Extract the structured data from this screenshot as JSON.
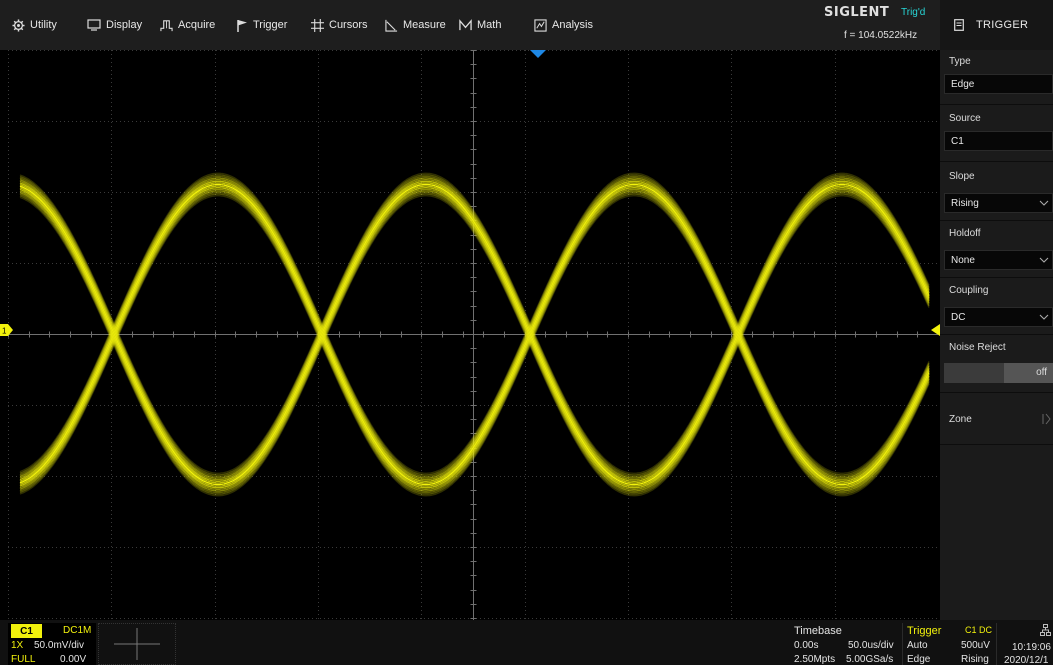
{
  "menu": {
    "items": [
      {
        "label": "Utility",
        "icon": "gear-icon"
      },
      {
        "label": "Display",
        "icon": "monitor-icon"
      },
      {
        "label": "Acquire",
        "icon": "acquire-icon"
      },
      {
        "label": "Trigger",
        "icon": "flag-icon"
      },
      {
        "label": "Cursors",
        "icon": "cursors-icon"
      },
      {
        "label": "Measure",
        "icon": "measure-icon"
      },
      {
        "label": "Math",
        "icon": "math-icon"
      },
      {
        "label": "Analysis",
        "icon": "analysis-icon"
      }
    ]
  },
  "brand": {
    "name": "SIGLENT",
    "trigger_state": "Trig'd",
    "frequency": "f = 104.0522kHz"
  },
  "panel": {
    "title": "TRIGGER",
    "type": {
      "label": "Type",
      "value": "Edge"
    },
    "source": {
      "label": "Source",
      "value": "C1"
    },
    "slope": {
      "label": "Slope",
      "value": "Rising"
    },
    "holdoff": {
      "label": "Holdoff",
      "value": "None"
    },
    "coupling": {
      "label": "Coupling",
      "value": "DC"
    },
    "noise_reject": {
      "label": "Noise Reject",
      "value": "off"
    },
    "zone": {
      "label": "Zone"
    }
  },
  "channel1": {
    "tag": "C1",
    "coupling": "DC1M",
    "probe": "1X",
    "scale": "50.0mV/div",
    "bandwidth": "FULL",
    "offset": "0.00V"
  },
  "timebase": {
    "title": "Timebase",
    "delay": "0.00s",
    "scale": "50.0us/div",
    "points": "2.50Mpts",
    "sample_rate": "5.00GSa/s"
  },
  "trigger_info": {
    "title": "Trigger",
    "source_coupling": "C1 DC",
    "mode": "Auto",
    "level": "500uV",
    "type": "Edge",
    "slope": "Rising"
  },
  "clock": {
    "time": "10:19:06",
    "date": "2020/12/1"
  },
  "colors": {
    "channel1": "#f2f20c",
    "accent": "#27d6d6",
    "trigger_marker": "#1e88e5"
  }
}
